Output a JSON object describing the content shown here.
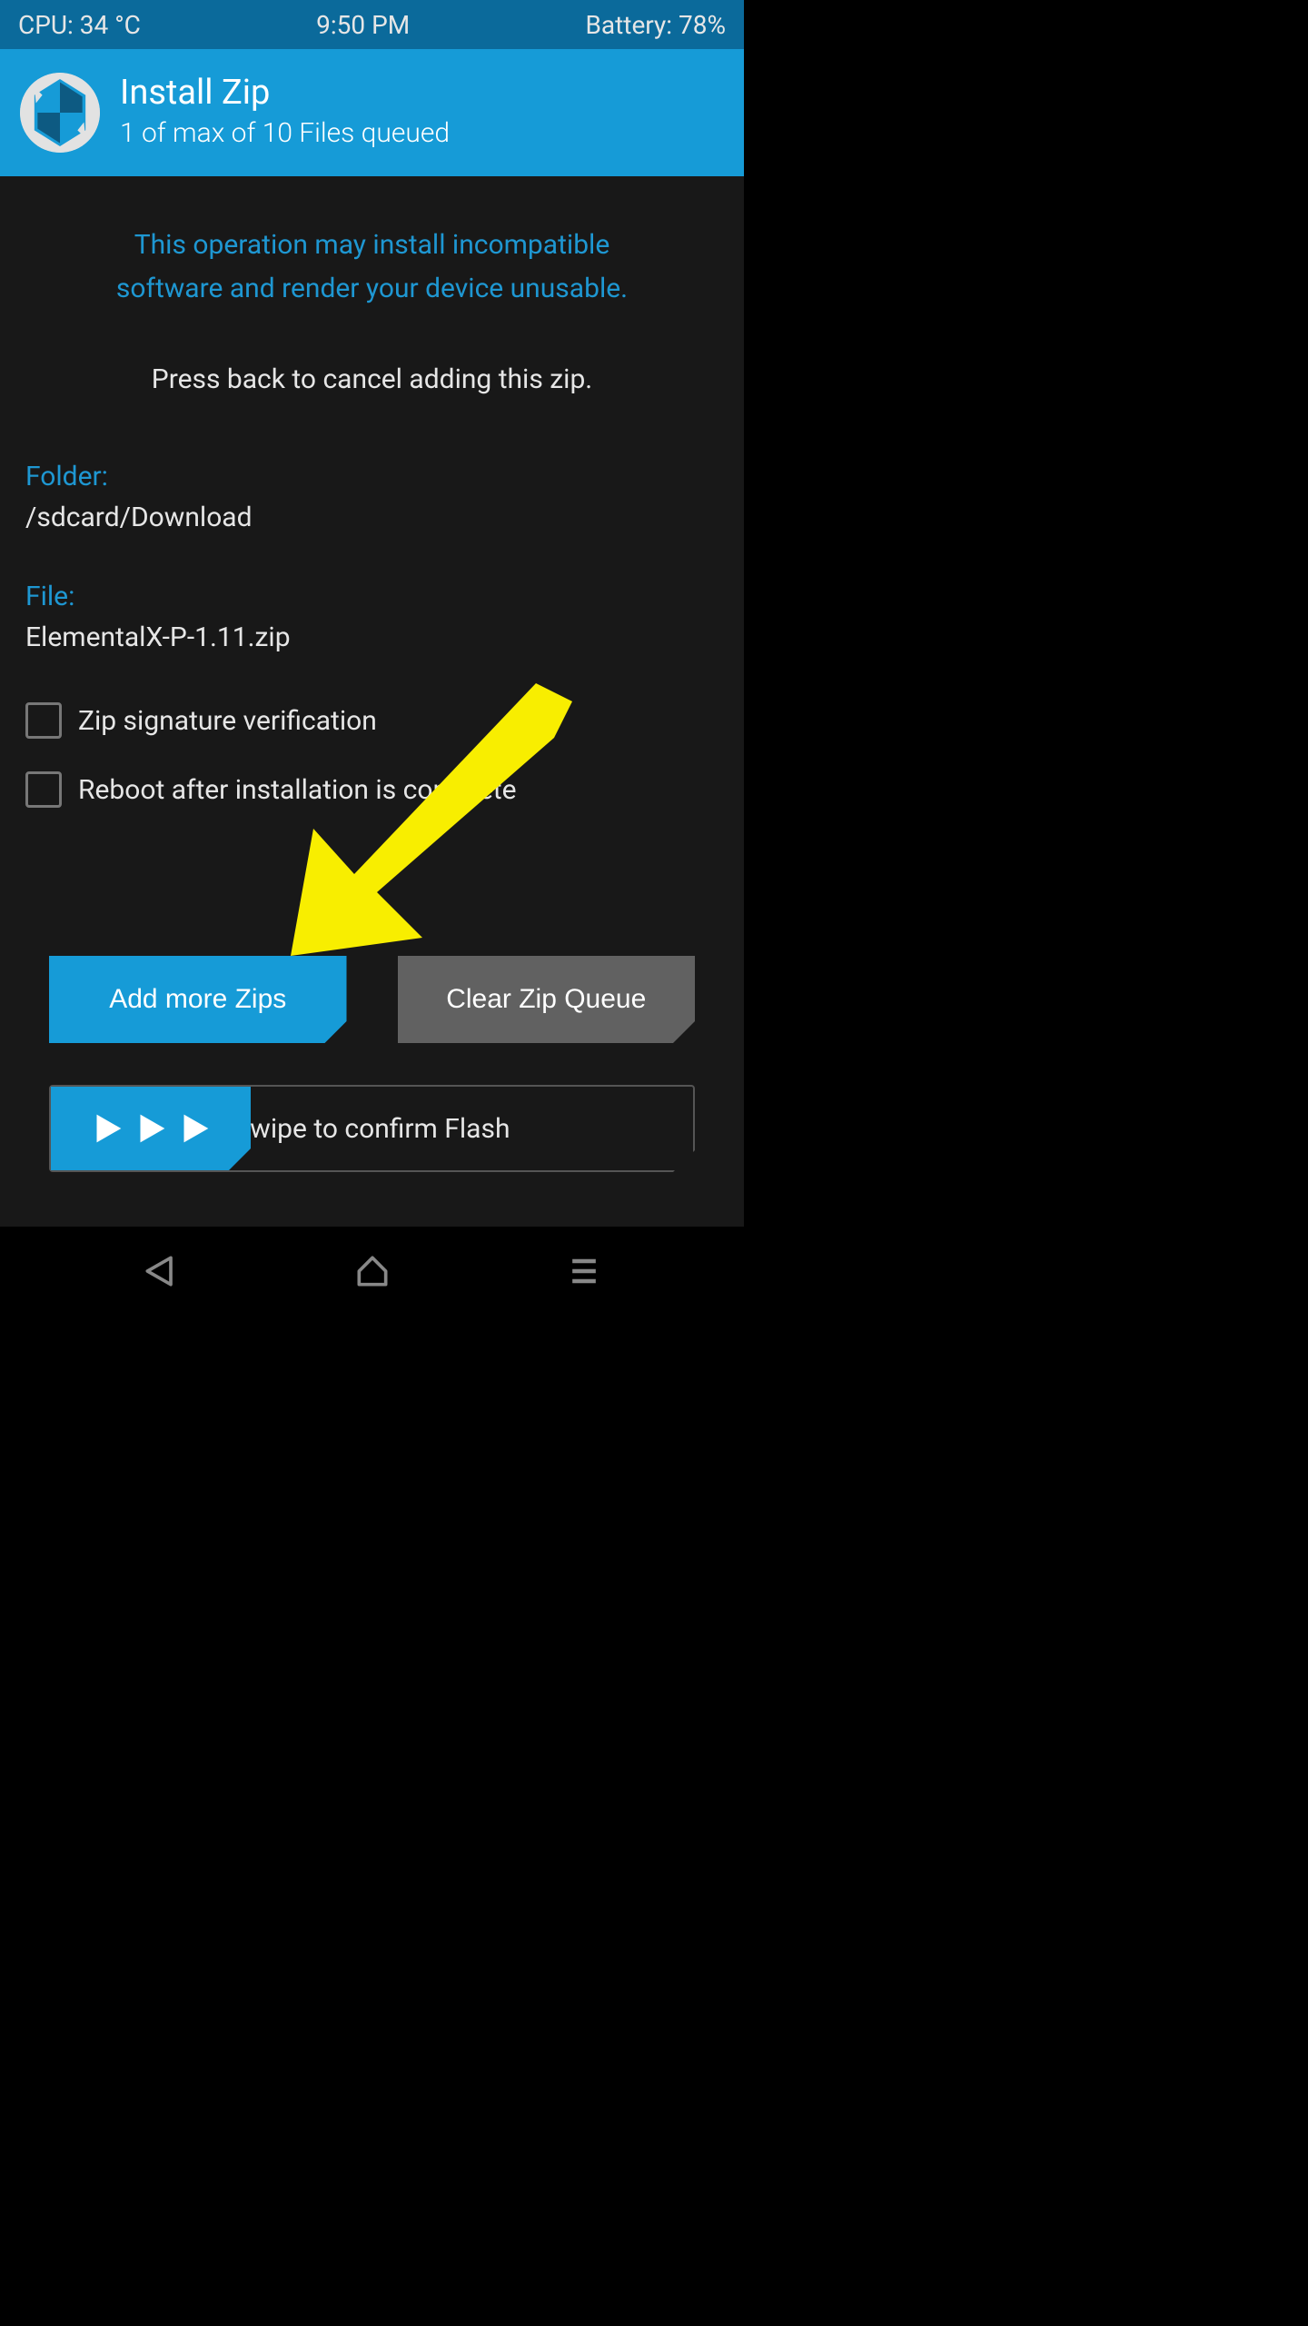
{
  "status": {
    "cpu": "CPU: 34 °C",
    "time": "9:50 PM",
    "battery": "Battery: 78%"
  },
  "header": {
    "title": "Install Zip",
    "subtitle": "1 of max of 10 Files queued"
  },
  "content": {
    "warning_line1": "This operation may install incompatible",
    "warning_line2": "software and render your device unusable.",
    "back_hint": "Press back to cancel adding this zip.",
    "folder_label": "Folder:",
    "folder_value": "/sdcard/Download",
    "file_label": "File:",
    "file_value": "ElementalX-P-1.11.zip",
    "check_sig": "Zip signature verification",
    "check_reboot": "Reboot after installation is complete"
  },
  "buttons": {
    "add_more": "Add more Zips",
    "clear_queue": "Clear Zip Queue"
  },
  "swipe": {
    "label": "Swipe to confirm Flash"
  },
  "colors": {
    "accent": "#169bd7",
    "accent_dark": "#0b6a9b",
    "bg_dark": "#181818",
    "text_light": "#e6e6e6"
  }
}
